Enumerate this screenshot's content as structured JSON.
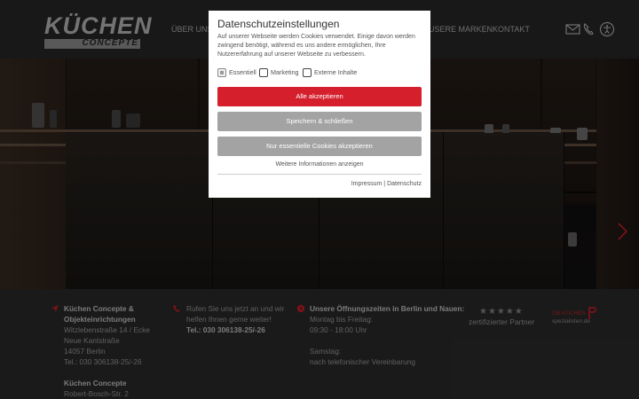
{
  "header": {
    "logo_main": "KÜCHEN",
    "logo_sub": "CONCEPTE",
    "nav": {
      "item1": "ÜBER UNS",
      "item_marken": "USERE MARKEN",
      "item_kontakt": "KONTAKT"
    },
    "icons": [
      "mail-icon",
      "phone-icon",
      "accessibility-icon"
    ]
  },
  "slider": {
    "slide_count": 4,
    "active_index": 0
  },
  "cookie_modal": {
    "title": "Datenschutzeinstellungen",
    "description": "Auf unserer Webseite werden Cookies verwendet. Einige davon werden zwingend benötigt, während es uns andere ermöglichen, Ihre Nutzererfahrung auf unserer Webseite zu verbessern.",
    "checkboxes": [
      {
        "label": "Essentiell",
        "checked": true
      },
      {
        "label": "Marketing",
        "checked": false
      },
      {
        "label": "Externe Inhalte",
        "checked": false
      }
    ],
    "accept_all": "Alle akzeptieren",
    "save_close": "Speichern & schließen",
    "essential_only": "Nur essentielle Cookies akzeptieren",
    "more_info": "Weitere Informationen anzeigen",
    "impressum": "Impressum",
    "separator": "|",
    "datenschutz": "Datenschutz",
    "accent_color": "#d51f2d"
  },
  "footer": {
    "company_name_1": "Küchen Concepte &",
    "company_name_2": "Objekteinrichtungen",
    "address_1": "Witzlebenstraße 14 / Ecke",
    "address_2": "Neue Kantstraße",
    "address_3": "14057 Berlin",
    "address_4": "Tel.: 030 306138-25/-26",
    "company2_name": "Küchen Concepte",
    "company2_address": "Robert-Bosch-Str. 2",
    "call_1": "Rufen Sie uns jetzt an und wir",
    "call_2": "helfen Ihnen gerne weiter!",
    "call_tel": "Tel.: 030 306138-25/-26",
    "hours_title": "Unsere Öffnungszeiten in Berlin und Nauen:",
    "hours_1": "Montag bis Freitag:",
    "hours_2": "09:30 - 18:00 Uhr",
    "hours_3": "Samstag:",
    "hours_4": "nach telefonischer Vereinbarung",
    "badge_stars": "★★★★★",
    "badge_partner": "zertifizierter Partner",
    "badge2_top": "DIE KÜCHEN-",
    "badge2_bottom": "spezialisten.de"
  }
}
